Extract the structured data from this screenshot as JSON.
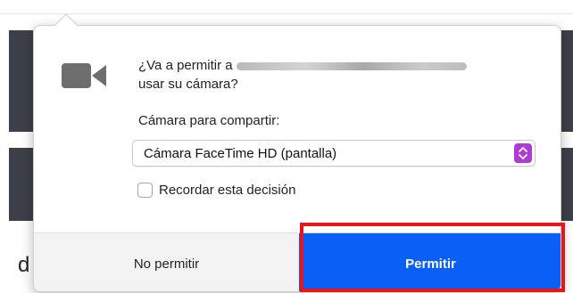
{
  "background": {
    "letter": "d"
  },
  "dialog": {
    "icon": "video-camera-icon",
    "question_line1": "¿Va a permitir a",
    "question_line2": "usar su cámara?",
    "share_label": "Cámara para compartir:",
    "camera_select": {
      "selected": "Cámara FaceTime HD (pantalla)"
    },
    "remember": {
      "label": "Recordar esta decisión",
      "checked": false
    },
    "buttons": {
      "deny": "No permitir",
      "allow": "Permitir"
    }
  },
  "colors": {
    "allow_button": "#0a60f6",
    "select_stepper": "#b13ad6",
    "highlight_box": "#e8151b",
    "background_panels": "#3d4048"
  }
}
